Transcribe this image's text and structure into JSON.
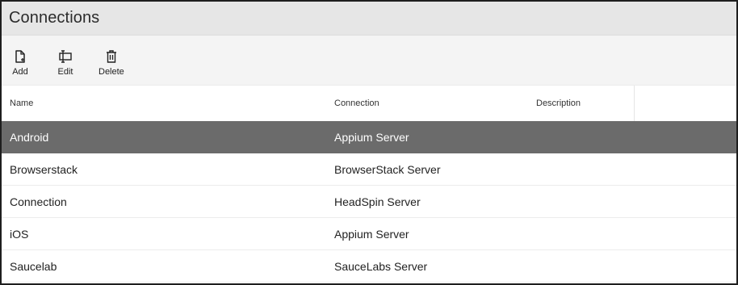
{
  "window": {
    "title": "Connections"
  },
  "toolbar": {
    "add_label": "Add",
    "edit_label": "Edit",
    "delete_label": "Delete"
  },
  "table": {
    "columns": {
      "name": "Name",
      "connection": "Connection",
      "description": "Description"
    },
    "rows": [
      {
        "name": "Android",
        "connection": "Appium Server",
        "description": "",
        "selected": true
      },
      {
        "name": "Browserstack",
        "connection": "BrowserStack Server",
        "description": ""
      },
      {
        "name": "Connection",
        "connection": "HeadSpin Server",
        "description": ""
      },
      {
        "name": "iOS",
        "connection": "Appium Server",
        "description": ""
      },
      {
        "name": "Saucelab",
        "connection": "SauceLabs Server",
        "description": ""
      }
    ]
  },
  "colors": {
    "selected_row": "#6b6b6b",
    "titlebar": "#e6e6e6",
    "toolbar": "#f4f4f4"
  },
  "icons": {
    "add": "add-document-icon",
    "edit": "edit-icon",
    "delete": "trash-icon"
  }
}
